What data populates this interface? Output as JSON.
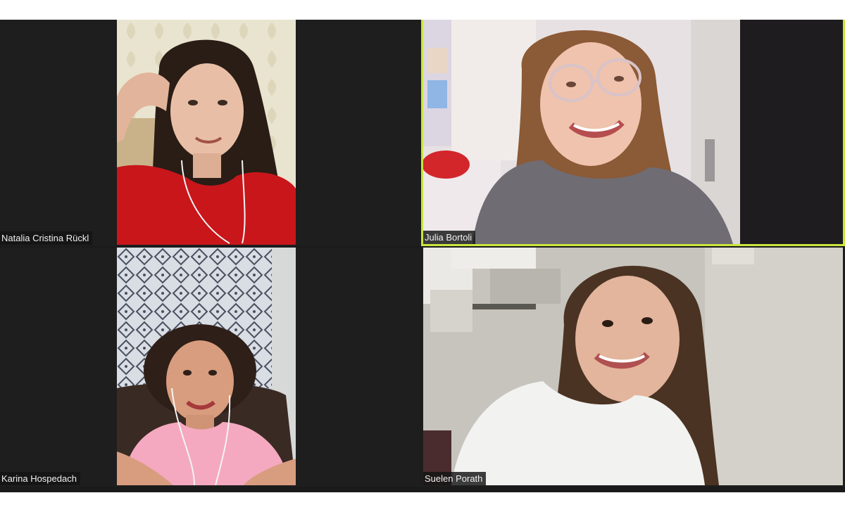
{
  "meeting": {
    "view": "gallery",
    "active_speaker": "Julia Bortoli"
  },
  "participants": [
    {
      "name": "Natalia Cristina Rückl",
      "shirt_color": "#c8161b",
      "is_speaking": false
    },
    {
      "name": "Julia Bortoli",
      "shirt_color": "#6f6c73",
      "is_speaking": true
    },
    {
      "name": "Karina Hospedach",
      "shirt_color": "#f4a9c0",
      "is_speaking": false
    },
    {
      "name": "Suelen Porath",
      "shirt_color": "#f2f2f0",
      "is_speaking": false
    }
  ],
  "colors": {
    "tile_background": "#1e1e1e",
    "speaker_highlight": "#c8e63c",
    "label_background": "#141414",
    "label_text": "#f2f2f2"
  }
}
